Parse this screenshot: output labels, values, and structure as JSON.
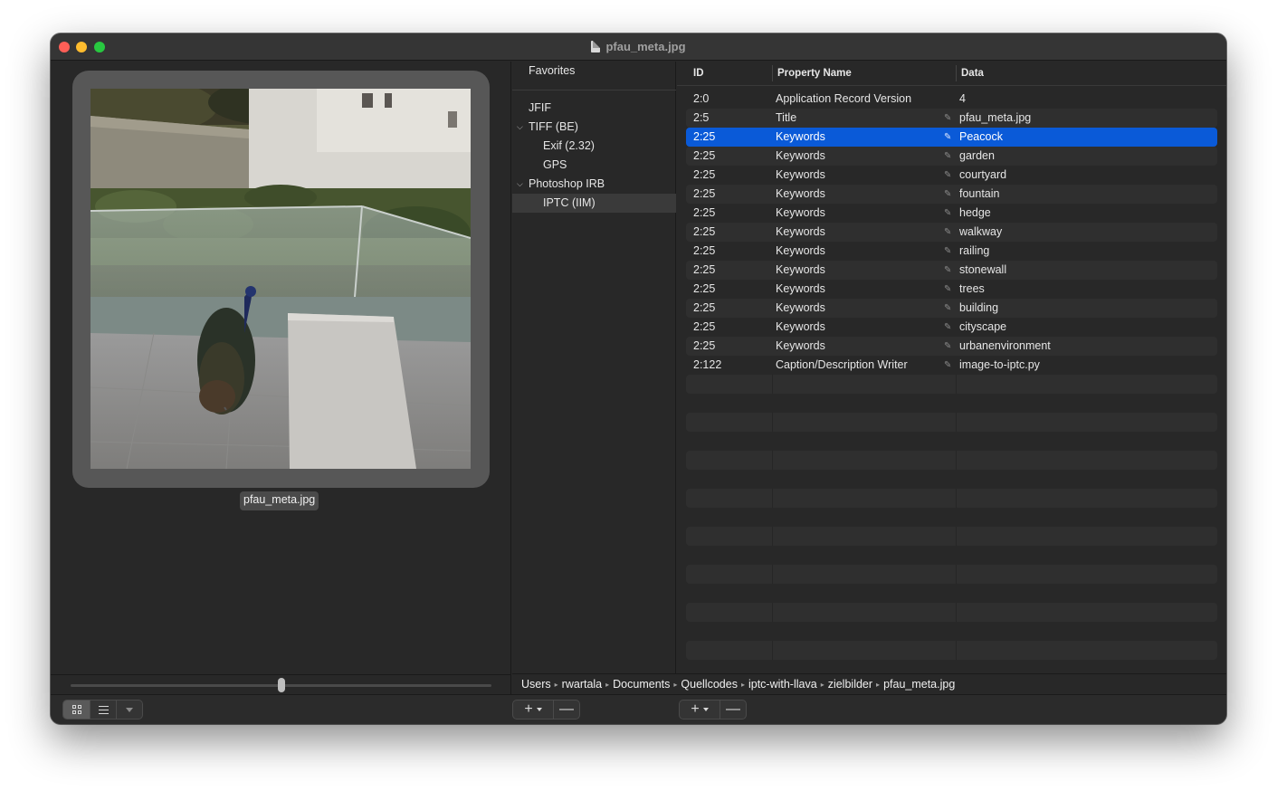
{
  "window": {
    "title": "pfau_meta.jpg"
  },
  "browser": {
    "file_label": "pfau_meta.jpg",
    "zoom_fraction": 0.51
  },
  "sidebar": {
    "favorites_label": "Favorites",
    "items": [
      {
        "label": "JFIF",
        "expanded": null
      },
      {
        "label": "TIFF (BE)",
        "expanded": true
      },
      {
        "label": "Exif (2.32)",
        "expanded": null
      },
      {
        "label": "GPS",
        "expanded": null
      },
      {
        "label": "Photoshop IRB",
        "expanded": true
      },
      {
        "label": "IPTC (IIM)",
        "expanded": null,
        "selected": true
      }
    ]
  },
  "table": {
    "headers": {
      "id": "ID",
      "name": "Property Name",
      "data": "Data"
    },
    "rows": [
      {
        "id": "2:0",
        "name": "Application Record Version",
        "data": "4",
        "editable": false
      },
      {
        "id": "2:5",
        "name": "Title",
        "data": "pfau_meta.jpg",
        "editable": true
      },
      {
        "id": "2:25",
        "name": "Keywords",
        "data": "Peacock",
        "editable": true,
        "selected": true
      },
      {
        "id": "2:25",
        "name": "Keywords",
        "data": "garden",
        "editable": true
      },
      {
        "id": "2:25",
        "name": "Keywords",
        "data": "courtyard",
        "editable": true
      },
      {
        "id": "2:25",
        "name": "Keywords",
        "data": "fountain",
        "editable": true
      },
      {
        "id": "2:25",
        "name": "Keywords",
        "data": "hedge",
        "editable": true
      },
      {
        "id": "2:25",
        "name": "Keywords",
        "data": "walkway",
        "editable": true
      },
      {
        "id": "2:25",
        "name": "Keywords",
        "data": "railing",
        "editable": true
      },
      {
        "id": "2:25",
        "name": "Keywords",
        "data": "stonewall",
        "editable": true
      },
      {
        "id": "2:25",
        "name": "Keywords",
        "data": "trees",
        "editable": true
      },
      {
        "id": "2:25",
        "name": "Keywords",
        "data": "building",
        "editable": true
      },
      {
        "id": "2:25",
        "name": "Keywords",
        "data": "cityscape",
        "editable": true
      },
      {
        "id": "2:25",
        "name": "Keywords",
        "data": "urbanenvironment",
        "editable": true
      },
      {
        "id": "2:122",
        "name": "Caption/Description Writer",
        "data": "image-to-iptc.py",
        "editable": true
      }
    ],
    "selection_color": "#0a5ad8"
  },
  "path_bar": {
    "segments": [
      "Users",
      "rwartala",
      "Documents",
      "Quellcodes",
      "iptc-with-llava",
      "zielbilder",
      "pfau_meta.jpg"
    ]
  },
  "toolbar": {
    "view_mode": "grid",
    "plus_symbol": "+",
    "minus_symbol": "—"
  },
  "icons": {
    "document": "document-icon",
    "pencil": "pencil-icon",
    "grid": "grid-view-icon",
    "list": "list-view-icon"
  }
}
